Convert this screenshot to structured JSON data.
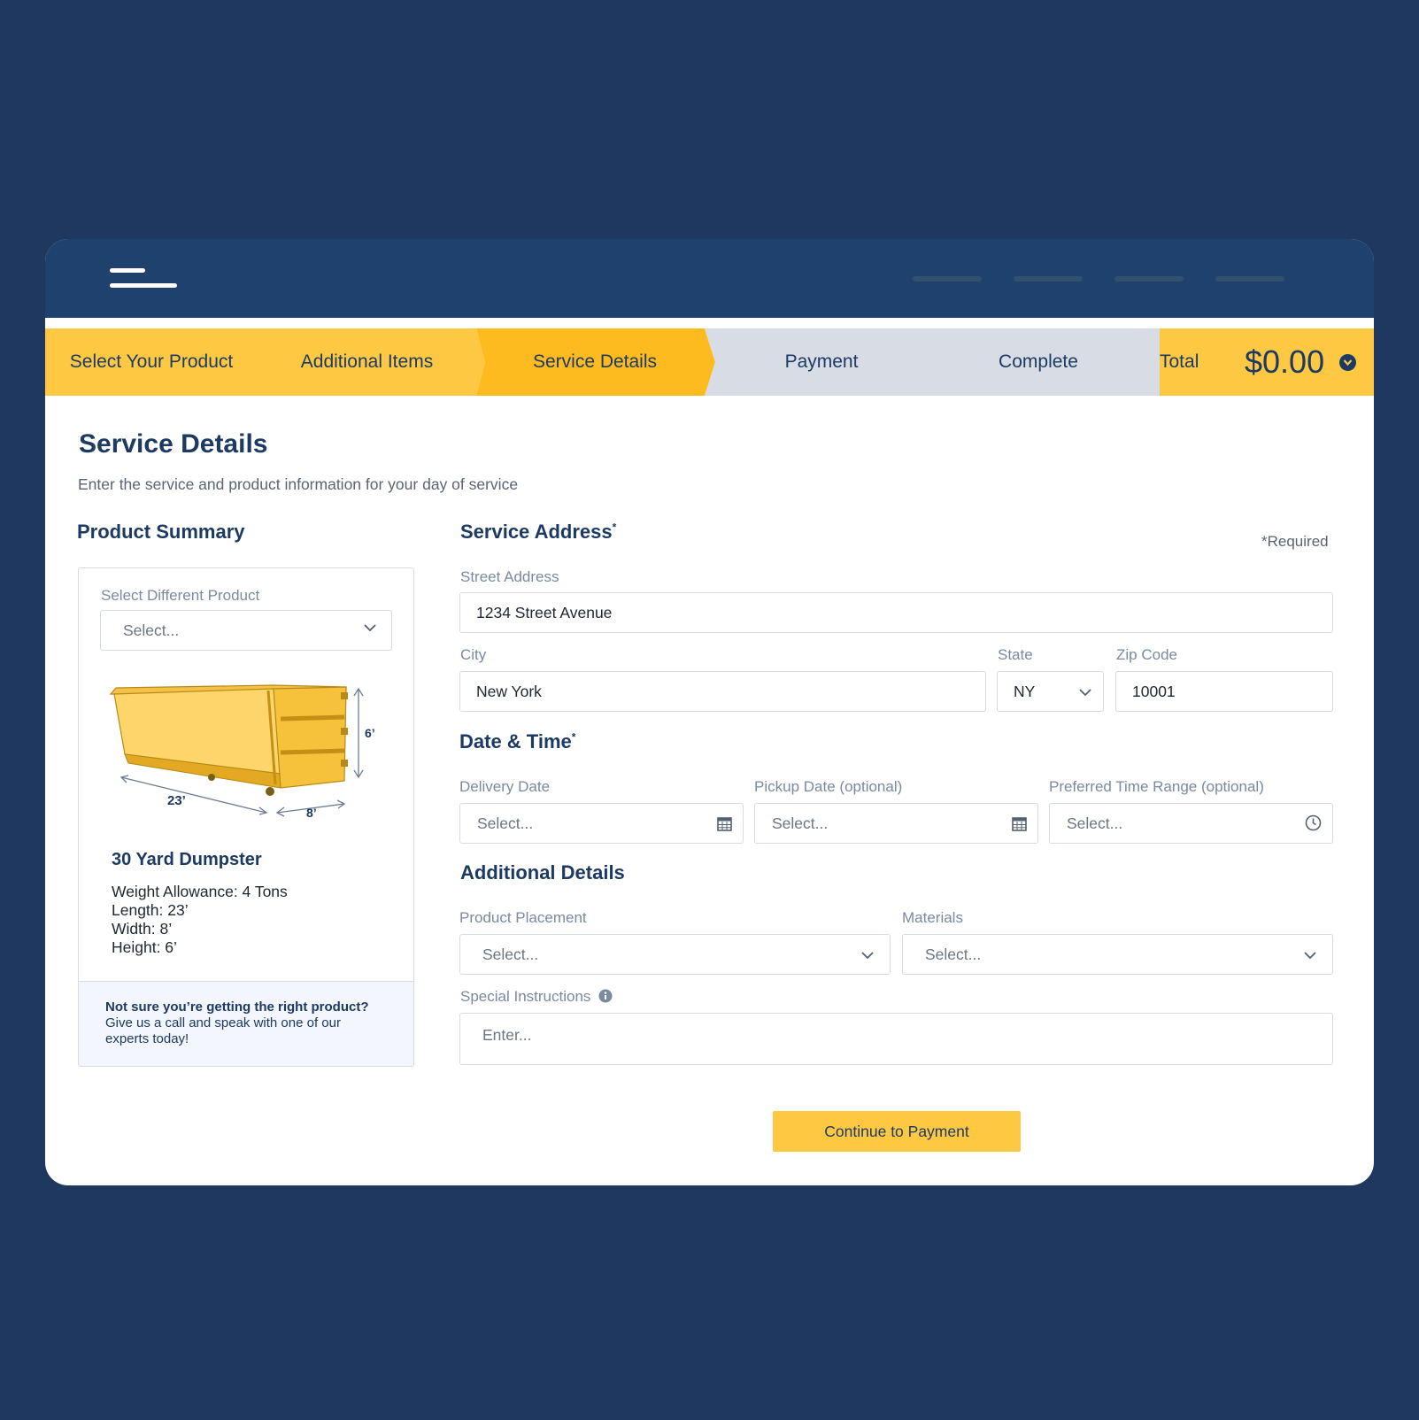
{
  "header": {
    "menu_icon": "hamburger-menu-icon"
  },
  "stepper": {
    "steps": [
      {
        "label": "Select Your Product",
        "state": "done"
      },
      {
        "label": "Additional Items",
        "state": "done"
      },
      {
        "label": "Service Details",
        "state": "active"
      },
      {
        "label": "Payment",
        "state": "pending"
      },
      {
        "label": "Complete",
        "state": "pending"
      }
    ],
    "total_label": "Total",
    "total_value": "$0.00"
  },
  "page": {
    "title": "Service Details",
    "subtitle": "Enter the service and product information for your day of service",
    "required_note": "*Required"
  },
  "product_summary": {
    "title": "Product Summary",
    "select_label": "Select Different Product",
    "select_placeholder": "Select...",
    "dims": {
      "length": "23’",
      "width": "8’",
      "height": "6’"
    },
    "product_name": "30 Yard Dumpster",
    "specs": [
      "Weight Allowance: 4 Tons",
      "Length: 23’",
      "Width: 8’",
      "Height: 6’"
    ],
    "help_title": "Not sure you’re getting the right product?",
    "help_text": "Give us a call and speak with one of our experts today!"
  },
  "service_address": {
    "title": "Service Address",
    "street_label": "Street Address",
    "street_value": "1234 Street Avenue",
    "city_label": "City",
    "city_value": "New York",
    "state_label": "State",
    "state_value": "NY",
    "zip_label": "Zip Code",
    "zip_value": "10001"
  },
  "date_time": {
    "title": "Date & Time",
    "delivery_label": "Delivery Date",
    "delivery_placeholder": "Select...",
    "pickup_label": "Pickup Date",
    "pickup_optional": "(optional)",
    "pickup_placeholder": "Select...",
    "time_label": "Preferred Time Range",
    "time_optional": "(optional)",
    "time_placeholder": "Select..."
  },
  "additional": {
    "title": "Additional Details",
    "placement_label": "Product Placement",
    "placement_placeholder": "Select...",
    "materials_label": "Materials",
    "materials_placeholder": "Select...",
    "instructions_label": "Special Instructions",
    "instructions_placeholder": "Enter..."
  },
  "cta": {
    "label": "Continue to Payment"
  },
  "colors": {
    "background": "#1e3860",
    "header": "#1e416e",
    "accent": "#fec843",
    "active_step": "#febb20",
    "pending_step": "#d8dce5",
    "text": "#1d3a63"
  }
}
